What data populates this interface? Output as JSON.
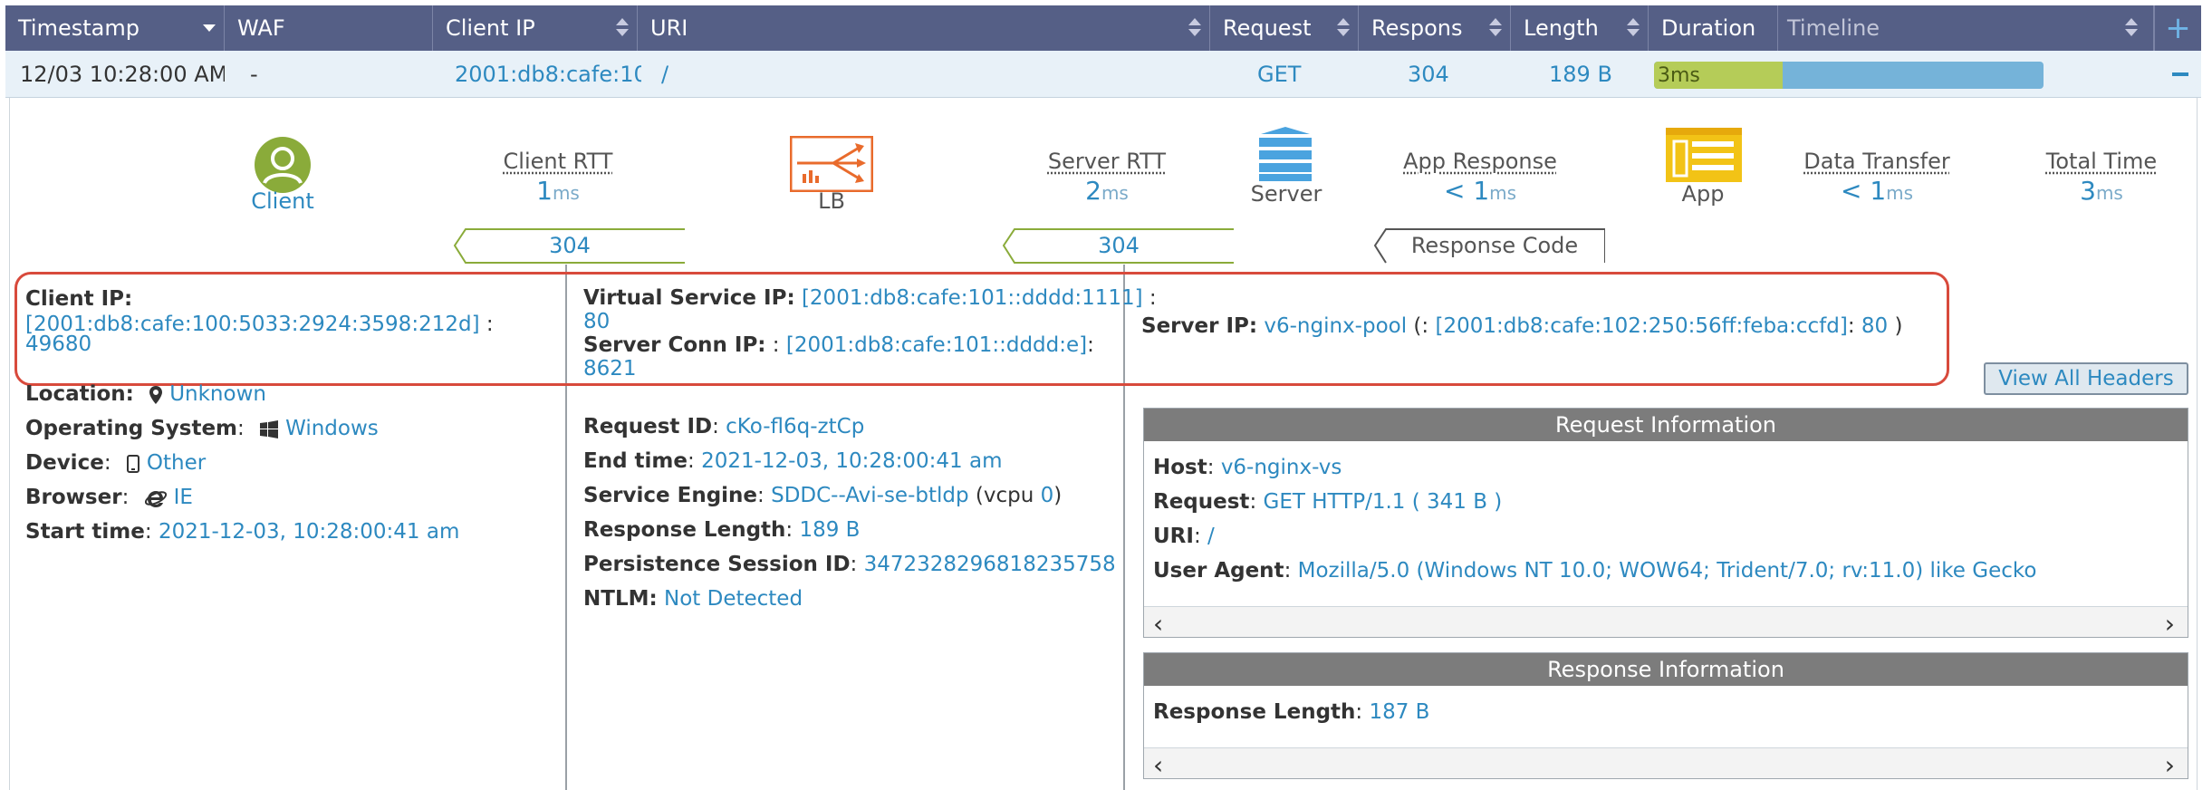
{
  "columns": {
    "timestamp": "Timestamp",
    "waf": "WAF",
    "client_ip": "Client IP",
    "uri": "URI",
    "request": "Request",
    "response": "Respons",
    "length": "Length",
    "duration": "Duration",
    "timeline": "Timeline",
    "add": "+"
  },
  "row": {
    "timestamp": "12/03 10:28:00 AM",
    "waf": "-",
    "client_ip": "2001:db8:cafe:10",
    "uri": "/",
    "request": "GET",
    "response": "304",
    "length": "189 B",
    "duration_label": "3ms",
    "duration_fraction": 0.33
  },
  "flow": {
    "client_label": "Client",
    "lb_label": "LB",
    "server_label": "Server",
    "app_label": "App",
    "client_rtt": {
      "title": "Client RTT",
      "value": "1",
      "unit": "ms"
    },
    "server_rtt": {
      "title": "Server RTT",
      "value": "2",
      "unit": "ms"
    },
    "app_response": {
      "title": "App Response",
      "value": "< 1",
      "unit": "ms"
    },
    "data_transfer": {
      "title": "Data Transfer",
      "value": "< 1",
      "unit": "ms"
    },
    "total_time": {
      "title": "Total Time",
      "value": "3",
      "unit": "ms"
    },
    "response_code_1": "304",
    "response_code_2": "304",
    "response_code_label": "Response Code"
  },
  "client": {
    "ip_label": "Client IP:",
    "ip_value": "[2001:db8:cafe:100:5033:2924:3598:212d]",
    "ip_sep": " :",
    "port": "49680",
    "location_label": "Location:",
    "location_value": "Unknown",
    "os_label": "Operating System",
    "os_value": "Windows",
    "device_label": "Device",
    "device_value": "Other",
    "browser_label": "Browser",
    "browser_value": "IE",
    "start_label": "Start time",
    "start_value": "2021-12-03, 10:28:00:41 am"
  },
  "service": {
    "vs_ip_label": "Virtual Service IP:",
    "vs_ip_value": "[2001:db8:cafe:101::dddd:1111]",
    "vs_ip_sep": " :",
    "vs_port": "80",
    "conn_ip_label": "Server Conn IP:",
    "conn_ip_sep": " :",
    "conn_ip_value": "[2001:db8:cafe:101::dddd:e]",
    "conn_ip_sep2": ":",
    "conn_port": "8621",
    "request_id_label": "Request ID",
    "request_id_value": "cKo-fl6q-ztCp",
    "end_time_label": "End time",
    "end_time_value": "2021-12-03, 10:28:00:41 am",
    "se_label": "Service Engine",
    "se_value": "SDDC--Avi-se-btldp",
    "se_vcpu_prefix": "(vcpu",
    "se_vcpu": "0",
    "se_vcpu_suffix": ")",
    "resp_len_label": "Response Length",
    "resp_len_value": "189 B",
    "persist_label": "Persistence Session ID",
    "persist_value": "3472328296818235758",
    "ntlm_label": "NTLM:",
    "ntlm_value": "Not Detected"
  },
  "server": {
    "ip_label": "Server IP:",
    "pool": "v6-nginx-pool",
    "open": " (: ",
    "ip_value": "[2001:db8:cafe:102:250:56ff:feba:ccfd]",
    "sep": ":",
    "port": "80",
    "close": " )"
  },
  "buttons": {
    "view_all_headers": "View All Headers"
  },
  "request_info": {
    "title": "Request Information",
    "host_label": "Host",
    "host_value": "v6-nginx-vs",
    "request_label": "Request",
    "request_value": "GET HTTP/1.1 ( 341 B )",
    "uri_label": "URI",
    "uri_value": "/",
    "ua_label": "User Agent",
    "ua_value": "Mozilla/5.0 (Windows NT 10.0; WOW64; Trident/7.0; rv:11.0) like Gecko"
  },
  "response_info": {
    "title": "Response Information",
    "len_label": "Response Length",
    "len_value": "187 B"
  },
  "colors": {
    "header_bg": "#555f86",
    "link": "#2d89c0",
    "accent_green": "#8aab3a",
    "accent_orange": "#e96b2c",
    "accent_yellow": "#f2c316",
    "highlight_red": "#d84a3c"
  }
}
